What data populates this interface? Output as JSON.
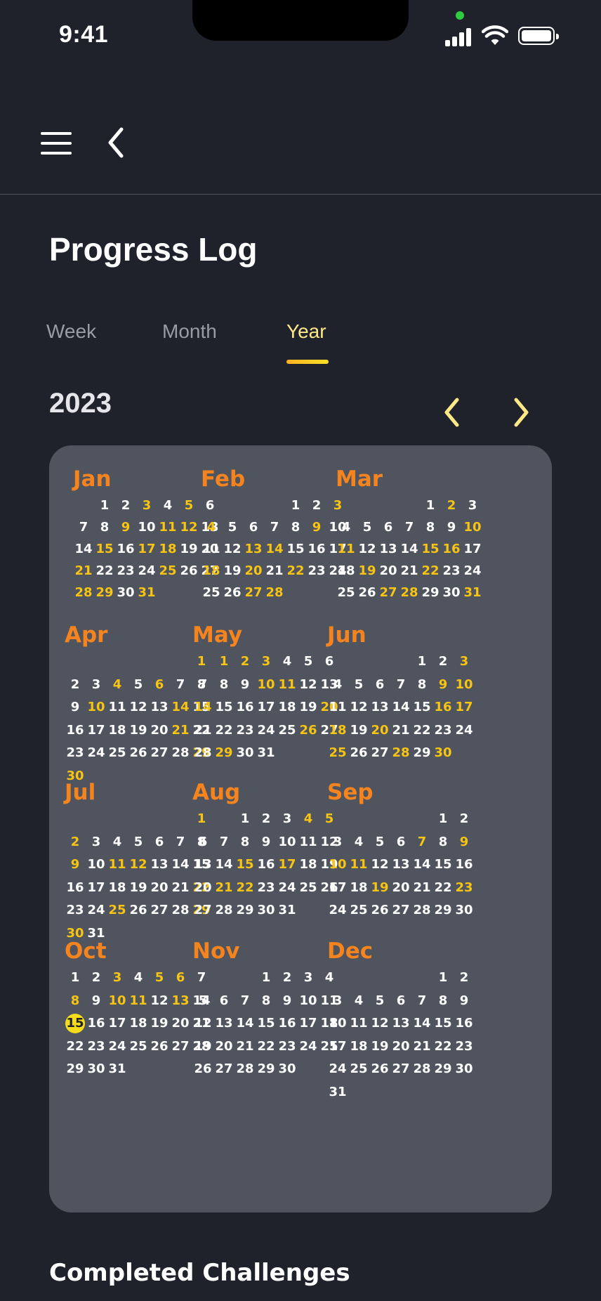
{
  "status_bar": {
    "time": "9:41"
  },
  "header": {
    "menu_icon": "hamburger-menu-icon",
    "back_icon": "chevron-left-icon"
  },
  "page": {
    "title": "Progress Log"
  },
  "tabs": [
    {
      "label": "Week",
      "active": false
    },
    {
      "label": "Month",
      "active": false
    },
    {
      "label": "Year",
      "active": true
    }
  ],
  "year_nav": {
    "year": "2023",
    "prev_icon": "chevron-left-icon",
    "next_icon": "chevron-right-icon"
  },
  "colors": {
    "accent_month": "#f5841f",
    "highlight_day": "#f7c414",
    "today_circle": "#f7dc1c",
    "card_bg": "#4f545e",
    "page_bg": "#1f212b",
    "active_tab": "#fce886"
  },
  "calendar": {
    "today": {
      "month": "Oct",
      "day": 15
    },
    "months": [
      {
        "name": "Jan",
        "days": 31,
        "start": 1,
        "highlighted": [
          3,
          5,
          9,
          11,
          12,
          15,
          17,
          18,
          21,
          25,
          28,
          29,
          31
        ]
      },
      {
        "name": "Feb",
        "days": 28,
        "start": 4,
        "highlighted": [
          3,
          4,
          9,
          13,
          14,
          18,
          20,
          22,
          27,
          28
        ]
      },
      {
        "name": "Mar",
        "days": 31,
        "start": 4,
        "highlighted": [
          2,
          10,
          11,
          15,
          16,
          19,
          22,
          27,
          28,
          31
        ]
      },
      {
        "name": "Apr",
        "days": 30,
        "start": 6,
        "highlighted": [
          1,
          4,
          6,
          10,
          14,
          21,
          29,
          30
        ]
      },
      {
        "name": "May",
        "days": 31,
        "start": 1,
        "highlighted": [
          1,
          2,
          3,
          10,
          11,
          14,
          20,
          26,
          29
        ]
      },
      {
        "name": "Jun",
        "days": 30,
        "start": 4,
        "highlighted": [
          3,
          9,
          10,
          16,
          17,
          18,
          20,
          25,
          28,
          30
        ]
      },
      {
        "name": "Jul",
        "days": 31,
        "start": 6,
        "highlighted": [
          1,
          2,
          9,
          11,
          12,
          22,
          25,
          29,
          30
        ]
      },
      {
        "name": "Aug",
        "days": 31,
        "start": 2,
        "highlighted": [
          4,
          5,
          15,
          17,
          21,
          22
        ]
      },
      {
        "name": "Sep",
        "days": 30,
        "start": 5,
        "highlighted": [
          7,
          9,
          10,
          11,
          19,
          23
        ]
      },
      {
        "name": "Oct",
        "days": 31,
        "start": 0,
        "highlighted": [
          3,
          5,
          6,
          8,
          10,
          11,
          13
        ]
      },
      {
        "name": "Nov",
        "days": 30,
        "start": 3,
        "highlighted": []
      },
      {
        "name": "Dec",
        "days": 31,
        "start": 5,
        "highlighted": []
      }
    ]
  },
  "sections": {
    "completed_title": "Completed Challenges"
  }
}
